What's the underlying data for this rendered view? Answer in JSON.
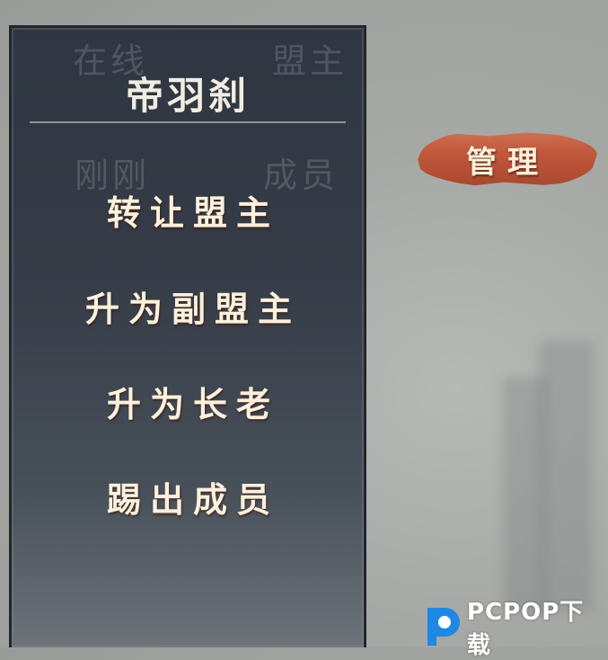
{
  "member_panel": {
    "ghost_labels": {
      "online": "在线",
      "leader": "盟主",
      "just_now": "刚刚",
      "member": "成员"
    },
    "player_name": "帝羽刹",
    "actions": [
      {
        "label": "转让盟主"
      },
      {
        "label": "升为副盟主"
      },
      {
        "label": "升为长老"
      },
      {
        "label": "踢出成员"
      }
    ]
  },
  "manage_button": {
    "label": "管理"
  },
  "colors": {
    "button_fill": "#c1573b",
    "panel_bg": "#353c47",
    "button_text": "#fbf1dc"
  },
  "watermark": {
    "brand": "PCPOP下载",
    "logo_icon": "pcpop-logo-icon"
  }
}
